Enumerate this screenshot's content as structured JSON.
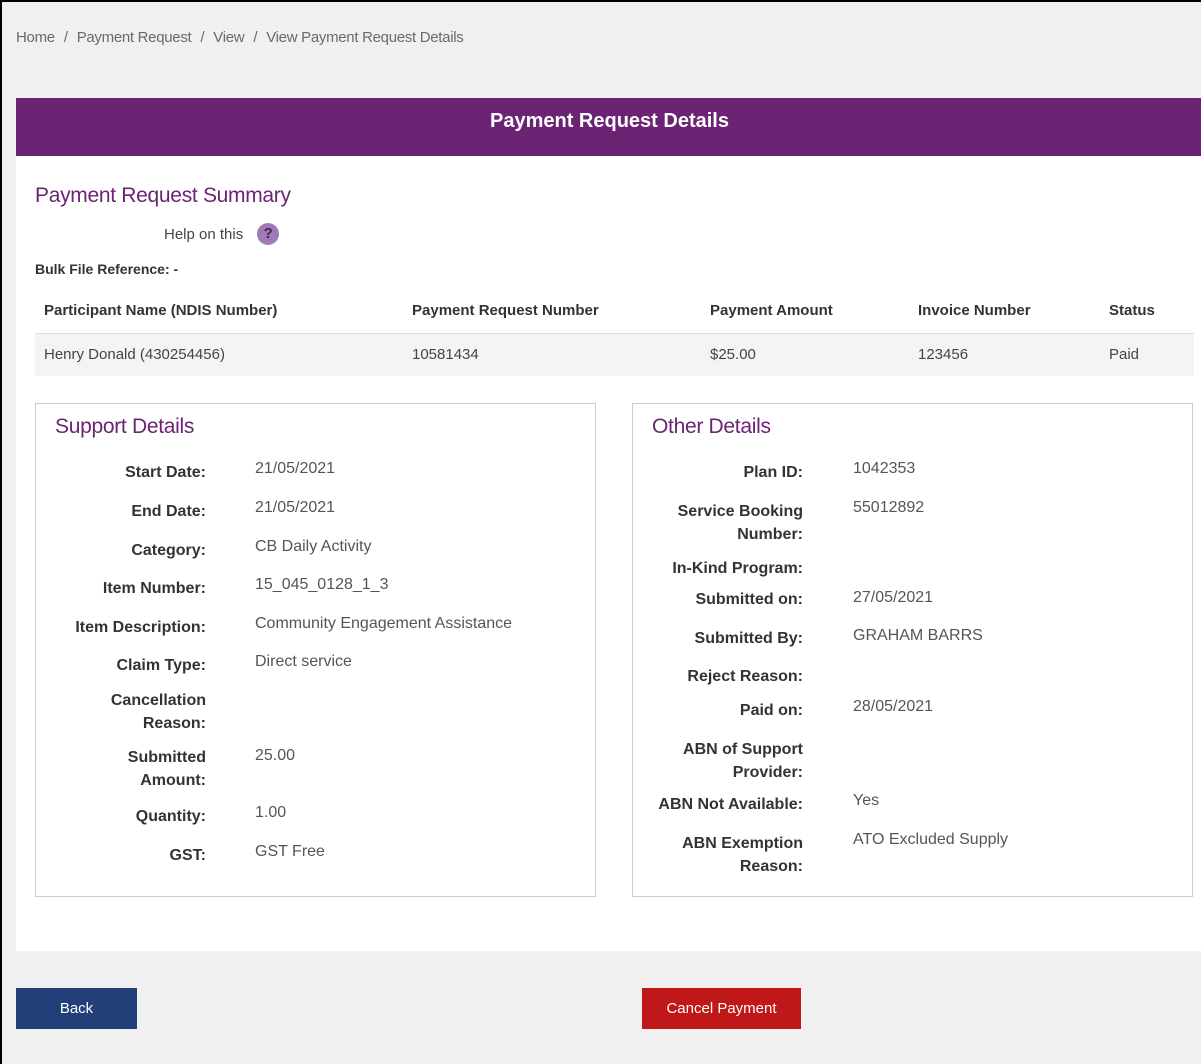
{
  "breadcrumb": [
    "Home",
    "Payment Request",
    "View",
    "View Payment Request Details"
  ],
  "banner_title": "Payment Request Details",
  "summary": {
    "title": "Payment Request Summary",
    "help_label": "Help on this",
    "help_icon": "?",
    "bulk_ref": "Bulk File Reference: -",
    "headers": [
      "Participant Name (NDIS Number)",
      "Payment Request Number",
      "Payment Amount",
      "Invoice Number",
      "Status"
    ],
    "row": [
      "Henry Donald (430254456)",
      "10581434",
      "$25.00",
      "123456",
      "Paid"
    ]
  },
  "support": {
    "title": "Support Details",
    "fields": [
      {
        "label": "Start Date:",
        "value": "21/05/2021"
      },
      {
        "label": "End Date:",
        "value": "21/05/2021"
      },
      {
        "label": "Category:",
        "value": "CB Daily Activity"
      },
      {
        "label": "Item Number:",
        "value": "15_045_0128_1_3"
      },
      {
        "label": "Item Description:",
        "value": "Community Engagement Assistance"
      },
      {
        "label": "Claim Type:",
        "value": "Direct service"
      },
      {
        "label": "Cancellation Reason:",
        "value": ""
      },
      {
        "label": "Submitted Amount:",
        "value": "25.00"
      },
      {
        "label": "Quantity:",
        "value": "1.00"
      },
      {
        "label": "GST:",
        "value": "GST Free"
      }
    ]
  },
  "other": {
    "title": "Other Details",
    "fields": [
      {
        "label": "Plan ID:",
        "value": "1042353"
      },
      {
        "label": "Service Booking Number:",
        "value": "55012892"
      },
      {
        "label": "In-Kind Program:",
        "value": ""
      },
      {
        "label": "Submitted on:",
        "value": "27/05/2021"
      },
      {
        "label": "Submitted By:",
        "value": "GRAHAM BARRS"
      },
      {
        "label": "Reject Reason:",
        "value": ""
      },
      {
        "label": "Paid on:",
        "value": "28/05/2021"
      },
      {
        "label": "ABN of Support Provider:",
        "value": ""
      },
      {
        "label": "ABN Not Available:",
        "value": "Yes"
      },
      {
        "label": "ABN Exemption Reason:",
        "value": "ATO Excluded Supply"
      }
    ]
  },
  "buttons": {
    "back": "Back",
    "cancel": "Cancel Payment"
  },
  "colors": {
    "brand_purple": "#6b2473",
    "back_blue": "#233f7a",
    "cancel_red": "#c01818"
  }
}
